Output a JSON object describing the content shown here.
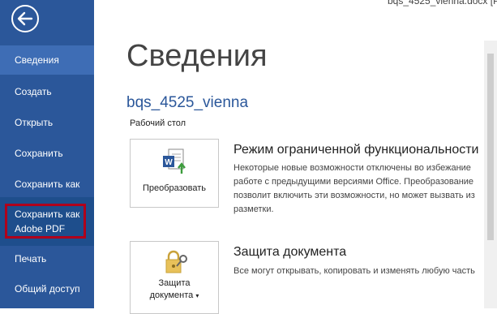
{
  "window": {
    "title_fragment": "bqs_4525_vienna.docx [Ре"
  },
  "sidebar": {
    "back_icon": "arrow-left-circle-icon",
    "items": [
      {
        "label": "Сведения",
        "active": true
      },
      {
        "label": "Создать"
      },
      {
        "label": "Открыть"
      },
      {
        "label": "Сохранить"
      },
      {
        "label": "Сохранить как"
      },
      {
        "label_line1": "Сохранить как",
        "label_line2": "Adobe PDF"
      },
      {
        "label": "Печать"
      },
      {
        "label": "Общий доступ"
      }
    ]
  },
  "main": {
    "title": "Сведения",
    "doc_name": "bqs_4525_vienna",
    "doc_path": "Рабочий стол"
  },
  "sections": [
    {
      "button_label": "Преобразовать",
      "icon": "word-convert-icon",
      "title": "Режим ограниченной функциональности",
      "lines": [
        "Некоторые новые возможности отключены во избежание",
        "работе с предыдущими версиями Office. Преобразование",
        "позволит включить эти возможности, но может вызвать из",
        "разметки."
      ]
    },
    {
      "button_label_line1": "Защита",
      "button_label_line2": "документа",
      "icon": "lock-key-icon",
      "title": "Защита документа",
      "lines": [
        "Все могут открывать, копировать и изменять любую часть"
      ]
    }
  ],
  "colors": {
    "sidebar": "#2b579a",
    "accent": "#2b579a",
    "highlight": "#b0001b"
  }
}
